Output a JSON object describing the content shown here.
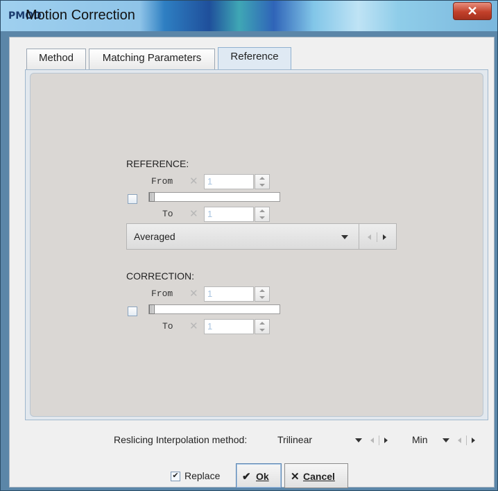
{
  "window": {
    "title": "Motion Correction",
    "title_icon": "PMOD",
    "close_icon": "close-icon"
  },
  "tabs": [
    {
      "label": "Method"
    },
    {
      "label": "Matching Parameters"
    },
    {
      "label": "Reference",
      "selected": true
    }
  ],
  "reference": {
    "label": "REFERENCE:",
    "from_label": "From",
    "to_label": "To",
    "from_value": "1",
    "to_value": "1",
    "checked": false,
    "combo_value": "Averaged"
  },
  "correction": {
    "label": "CORRECTION:",
    "from_label": "From",
    "to_label": "To",
    "from_value": "1",
    "to_value": "1",
    "checked": false
  },
  "reslicing": {
    "label": "Reslicing Interpolation method:",
    "value": "Trilinear",
    "second_value": "Min"
  },
  "footer": {
    "replace_label": "Replace",
    "replace_checked": true,
    "ok_label": "Ok",
    "cancel_label": "Cancel"
  },
  "colors": {
    "accent": "#5e87b2",
    "panel": "#dad7d4",
    "close": "#c2412b"
  }
}
